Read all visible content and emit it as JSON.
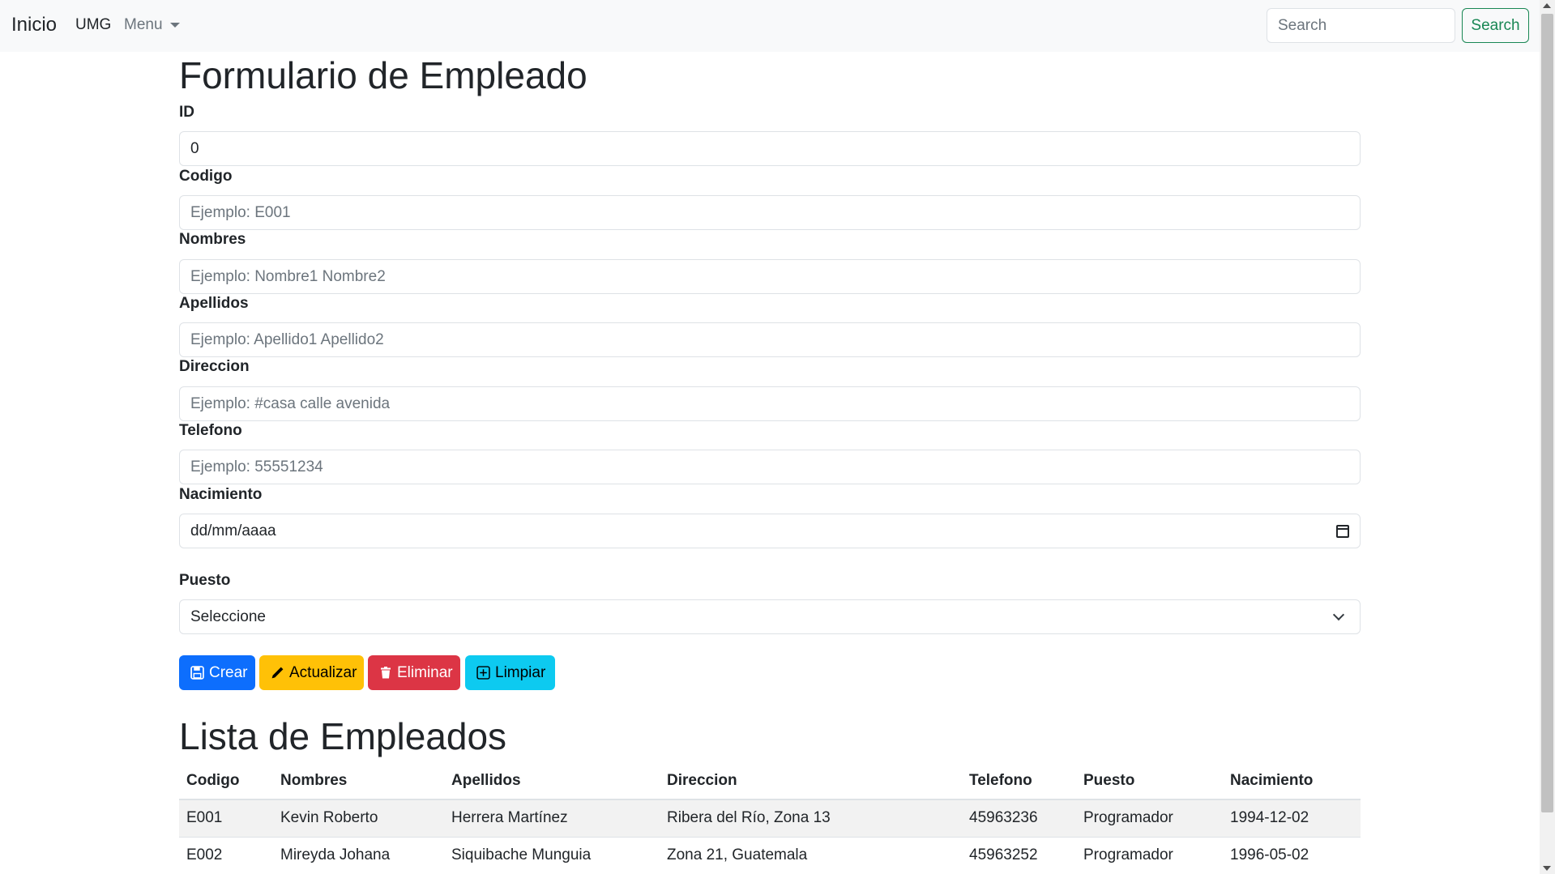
{
  "navbar": {
    "brand": "Inicio",
    "umg": "UMG",
    "menu": "Menu",
    "search_placeholder": "Search",
    "search_button": "Search"
  },
  "form": {
    "title": "Formulario de Empleado",
    "fields": {
      "id": {
        "label": "ID",
        "value": "0"
      },
      "codigo": {
        "label": "Codigo",
        "placeholder": "Ejemplo: E001"
      },
      "nombres": {
        "label": "Nombres",
        "placeholder": "Ejemplo: Nombre1 Nombre2"
      },
      "apellidos": {
        "label": "Apellidos",
        "placeholder": "Ejemplo: Apellido1 Apellido2"
      },
      "direccion": {
        "label": "Direccion",
        "placeholder": "Ejemplo: #casa calle avenida"
      },
      "telefono": {
        "label": "Telefono",
        "placeholder": "Ejemplo: 55551234"
      },
      "nacimiento": {
        "label": "Nacimiento",
        "value": "dd/mm/aaaa"
      },
      "puesto": {
        "label": "Puesto",
        "selected": "Seleccione"
      }
    },
    "buttons": {
      "crear": "Crear",
      "actualizar": "Actualizar",
      "eliminar": "Eliminar",
      "limpiar": "Limpiar"
    }
  },
  "list": {
    "title": "Lista de Empleados",
    "headers": [
      "Codigo",
      "Nombres",
      "Apellidos",
      "Direccion",
      "Telefono",
      "Puesto",
      "Nacimiento"
    ],
    "rows": [
      [
        "E001",
        "Kevin Roberto",
        "Herrera Martínez",
        "Ribera del Río, Zona 13",
        "45963236",
        "Programador",
        "1994-12-02"
      ],
      [
        "E002",
        "Mireyda Johana",
        "Siquibache Munguia",
        "Zona 21, Guatemala",
        "45963252",
        "Programador",
        "1996-05-02"
      ]
    ]
  },
  "colors": {
    "primary": "#0d6efd",
    "warning": "#ffc107",
    "danger": "#dc3545",
    "info": "#0dcaf0",
    "success": "#198754"
  }
}
